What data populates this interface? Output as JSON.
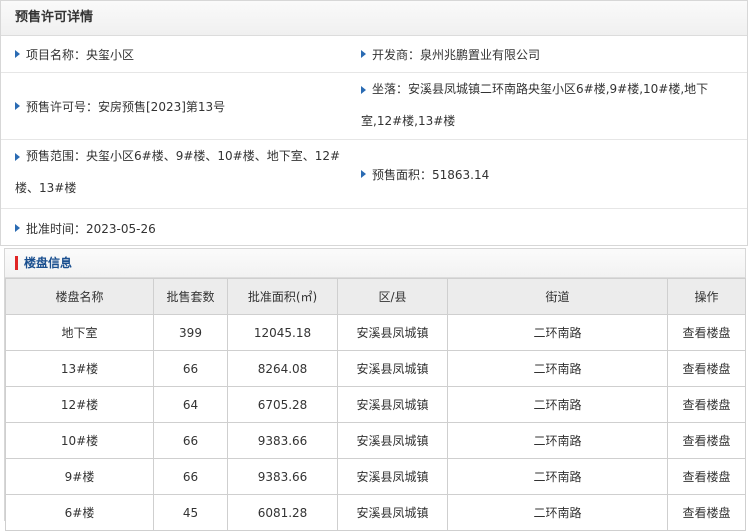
{
  "panel": {
    "title": "预售许可详情",
    "project_name": "项目名称：央玺小区",
    "developer": "开发商：泉州兆鹏置业有限公司",
    "permit_no": "预售许可号：安房预售[2023]第13号",
    "location": "坐落：安溪县凤城镇二环南路央玺小区6#楼,9#楼,10#楼,地下室,12#楼,13#楼",
    "scope": "预售范围：央玺小区6#楼、9#楼、10#楼、地下室、12#楼、13#楼",
    "area": "预售面积：51863.14",
    "approval_time": "批准时间：2023-05-26"
  },
  "section": {
    "title": "楼盘信息",
    "columns": [
      "楼盘名称",
      "批售套数",
      "批准面积(㎡)",
      "区/县",
      "街道",
      "操作"
    ],
    "rows": [
      {
        "name": "地下室",
        "count": "399",
        "area": "12045.18",
        "district": "安溪县凤城镇",
        "street": "二环南路",
        "action": "查看楼盘"
      },
      {
        "name": "13#楼",
        "count": "66",
        "area": "8264.08",
        "district": "安溪县凤城镇",
        "street": "二环南路",
        "action": "查看楼盘"
      },
      {
        "name": "12#楼",
        "count": "64",
        "area": "6705.28",
        "district": "安溪县凤城镇",
        "street": "二环南路",
        "action": "查看楼盘"
      },
      {
        "name": "10#楼",
        "count": "66",
        "area": "9383.66",
        "district": "安溪县凤城镇",
        "street": "二环南路",
        "action": "查看楼盘"
      },
      {
        "name": "9#楼",
        "count": "66",
        "area": "9383.66",
        "district": "安溪县凤城镇",
        "street": "二环南路",
        "action": "查看楼盘"
      },
      {
        "name": "6#楼",
        "count": "45",
        "area": "6081.28",
        "district": "安溪县凤城镇",
        "street": "二环南路",
        "action": "查看楼盘"
      }
    ]
  }
}
